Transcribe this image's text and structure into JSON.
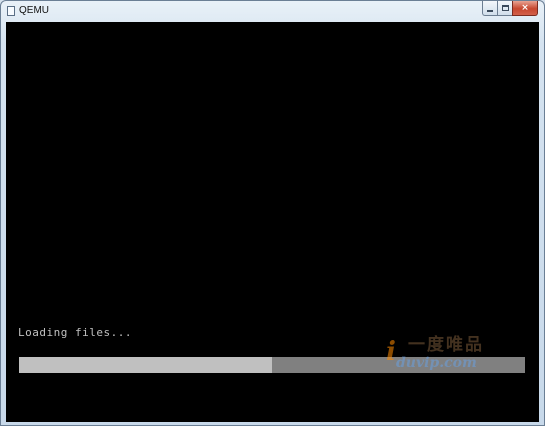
{
  "window": {
    "title": "QEMU",
    "icon": "qemu-app-icon",
    "buttons": {
      "minimize": "minimize-icon",
      "maximize": "maximize-icon",
      "close": "close-icon",
      "close_glyph": "×"
    }
  },
  "console": {
    "message": "Loading files...",
    "progress": 0.5,
    "colors": {
      "background": "#000000",
      "text": "#c0c0c0",
      "bar_track": "#808080",
      "bar_fill": "#c0c0c0"
    }
  },
  "watermark": {
    "logo_letter": "i",
    "chinese": "一度唯品",
    "url": "duvip.com"
  }
}
